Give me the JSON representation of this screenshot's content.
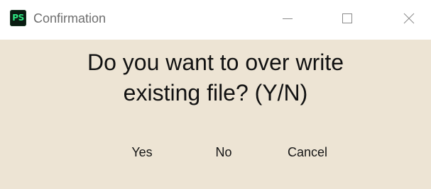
{
  "window": {
    "app_icon_text": "PS",
    "title": "Confirmation"
  },
  "dialog": {
    "message_line1": "Do you want to over write",
    "message_line2": "existing file? (Y/N)"
  },
  "buttons": {
    "yes_label": "Yes",
    "no_label": "No",
    "cancel_label": "Cancel"
  },
  "icons": {
    "app": "ps-app-icon",
    "minimize": "minimize-icon",
    "maximize": "maximize-icon",
    "close": "close-icon"
  },
  "colors": {
    "dialog_background": "#ede4d4",
    "titlebar_background": "#ffffff",
    "app_icon_background": "#0b1c12",
    "app_icon_text": "#2ee882",
    "title_text": "#6e6e6e",
    "message_text": "#111111"
  }
}
